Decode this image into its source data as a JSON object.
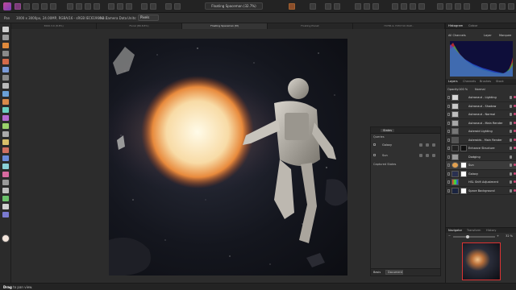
{
  "toolbar_top": {
    "app_menu_label": "",
    "document_selector": "Floating Spaceman (32.7%)"
  },
  "context_bar": {
    "pan_label": "Pan",
    "doc_info": "3000 x 3000px, 24.00MP, RGBA/16 - sRGB IEC61966-2.1",
    "camera_info": "No Camera Data",
    "units_label": "Units:",
    "units_value": "Pixels"
  },
  "document_tabs": [
    {
      "label": "3000.3.0 (8.8%)"
    },
    {
      "label": "Floral (86.8.8%)"
    },
    {
      "label": "Floating Spaceman (M)"
    },
    {
      "label": "Floating Planet"
    },
    {
      "label": "70786 & 7070710 WAP..."
    }
  ],
  "states_panel": {
    "title": "States",
    "queries_label": "Queries",
    "items": [
      {
        "label": "Galaxy"
      },
      {
        "label": "Sun"
      }
    ],
    "captured_label": "Captured States",
    "footer_label": "Basis",
    "footer_value": "Document"
  },
  "histogram_panel": {
    "tabs": [
      "Histogram",
      "Colour"
    ],
    "channel": "All Channels",
    "options": [
      "Layer",
      "Marquee"
    ]
  },
  "layers_panel": {
    "tabs": [
      "Layers",
      "Channels",
      "Brushes",
      "Stock"
    ],
    "opacity_label": "Opacity:",
    "opacity_value": "100 %",
    "blend_mode": "Normal",
    "layers": [
      {
        "name": "Astronaut - Lighting"
      },
      {
        "name": "Astronaut - Shadow"
      },
      {
        "name": "Astronaut - Normal"
      },
      {
        "name": "Astronaut - Main Render"
      },
      {
        "name": "Asteroid Lighting"
      },
      {
        "name": "Asteroids - Main Render"
      },
      {
        "name": "Enhance Structure"
      },
      {
        "name": "Dodging"
      },
      {
        "name": "Sun"
      },
      {
        "name": "Galaxy"
      },
      {
        "name": "HSL Shift Adjustment"
      },
      {
        "name": "Space Background"
      }
    ]
  },
  "navigator_panel": {
    "tabs": [
      "Navigator",
      "Transform",
      "History"
    ],
    "zoom_value": "32 %"
  },
  "status_bar": {
    "bold": "Drag",
    "text": "to pan view."
  },
  "colors": {
    "accent": "#d04a7a",
    "app_bg": "#2a2a2a",
    "panel_bg": "#2e2e2e"
  }
}
